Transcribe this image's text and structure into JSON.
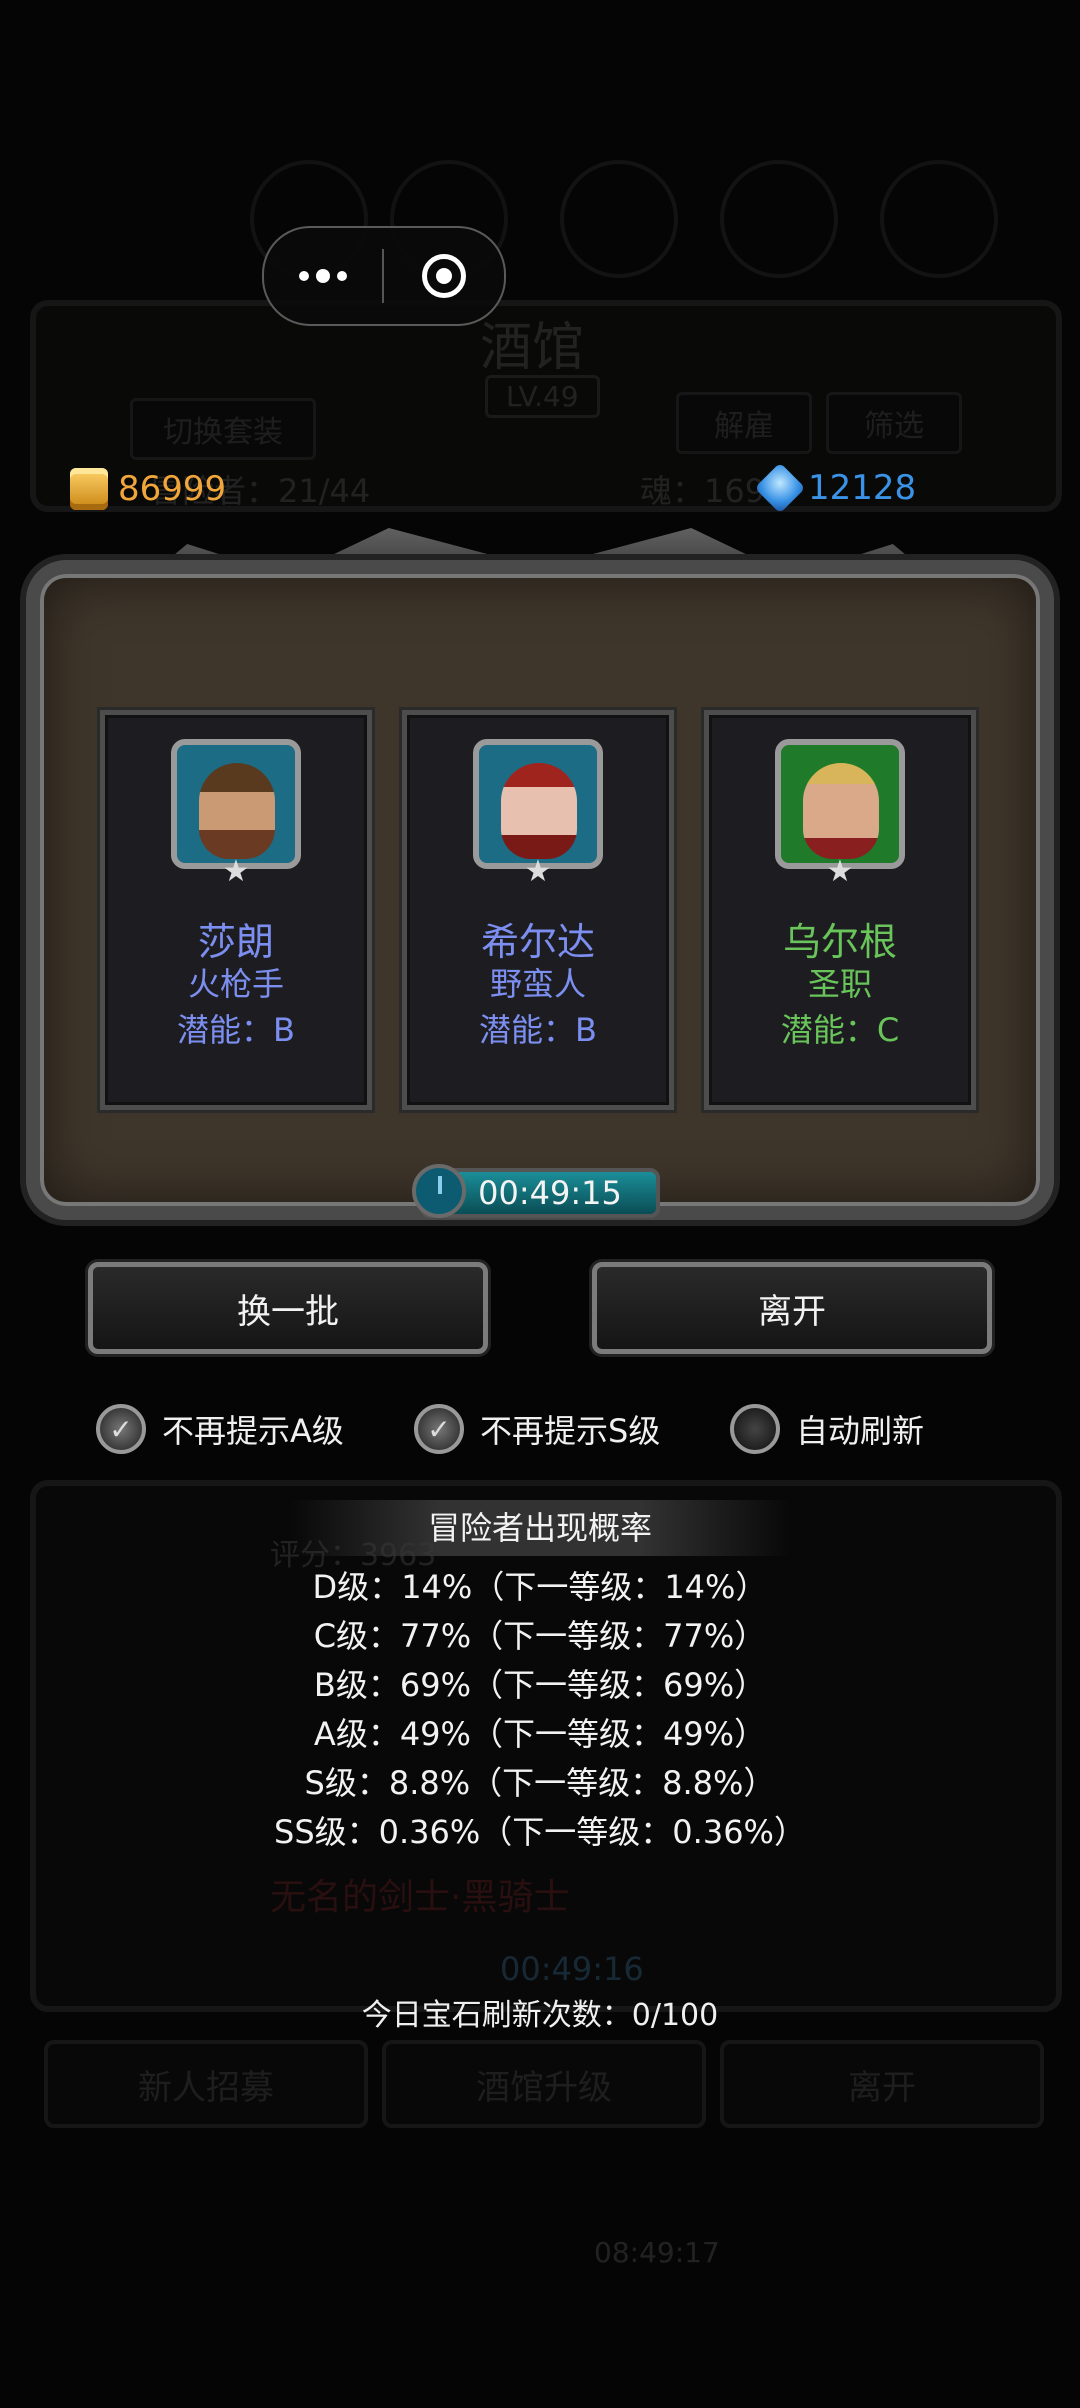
{
  "background": {
    "title": "酒馆",
    "level": "LV.49",
    "switch_outfit": "切换套装",
    "dismiss": "解雇",
    "filter": "筛选",
    "adventurer_count": "冒险者：21/44",
    "soul": "魂：1692",
    "list_score": "评分：3963",
    "list_name": "无名的剑士·黑骑士",
    "bg_timer": "00:49:16",
    "recruit": "新人招募",
    "upgrade": "酒馆升级",
    "leave": "离开",
    "bottom_timer": "08:49:17"
  },
  "currency": {
    "gold": "86999",
    "gems": "12128"
  },
  "heroes": [
    {
      "name": "莎朗",
      "class": "火枪手",
      "potential": "潜能：B",
      "icon": "cowboy-hat-woman-portrait"
    },
    {
      "name": "希尔达",
      "class": "野蛮人",
      "potential": "潜能：B",
      "icon": "red-hair-woman-portrait"
    },
    {
      "name": "乌尔根",
      "class": "圣职",
      "potential": "潜能：C",
      "icon": "blond-man-portrait"
    }
  ],
  "timer": "00:49:15",
  "buttons": {
    "refresh": "换一批",
    "leave": "离开"
  },
  "options": [
    {
      "label": "不再提示A级",
      "checked": true
    },
    {
      "label": "不再提示S级",
      "checked": true
    },
    {
      "label": "自动刷新",
      "checked": false
    }
  ],
  "probability": {
    "title": "冒险者出现概率",
    "lines": [
      "D级：14%（下一等级：14%）",
      "C级：77%（下一等级：77%）",
      "B级：69%（下一等级：69%）",
      "A级：49%（下一等级：49%）",
      "S级：8.8%（下一等级：8.8%）",
      "SS级：0.36%（下一等级：0.36%）"
    ]
  },
  "gem_refresh": "今日宝石刷新次数：0/100",
  "colors": {
    "gold": "#f0a63a",
    "gem": "#3a93e6",
    "potential_b": "#7c8ff0",
    "potential_c": "#69c45a"
  }
}
